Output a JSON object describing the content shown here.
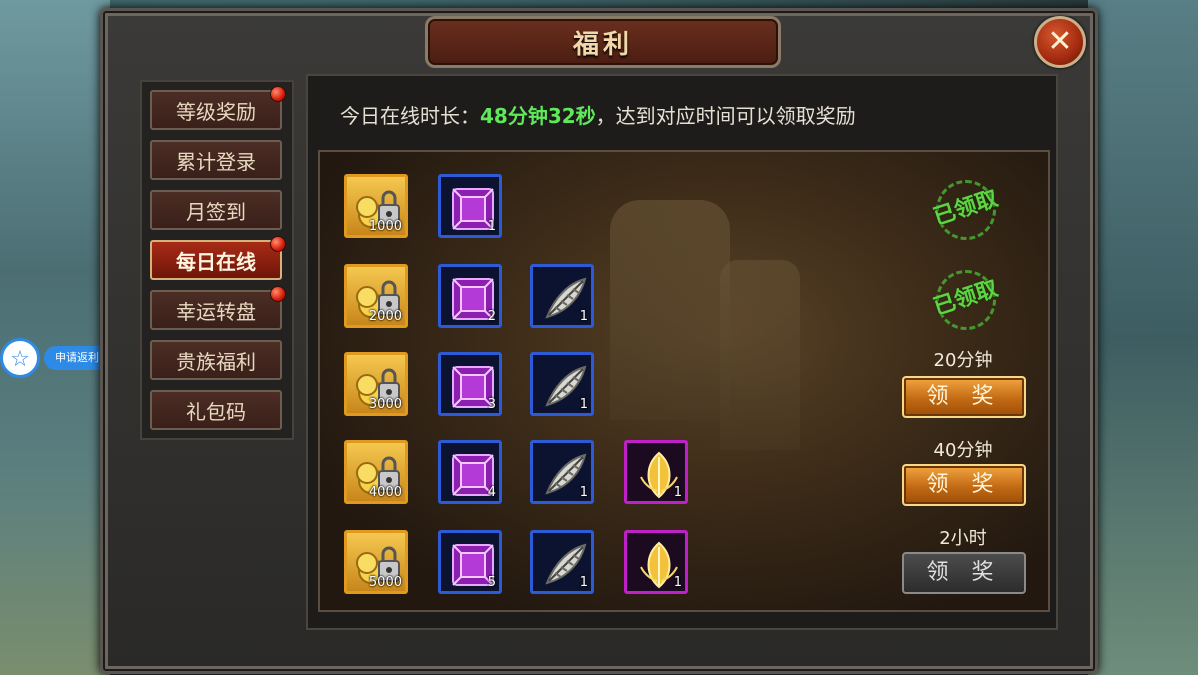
{
  "window": {
    "title": "福利",
    "close_label": "✕"
  },
  "tabs": [
    {
      "label": "等级奖励",
      "badge": true,
      "active": false
    },
    {
      "label": "累计登录",
      "badge": false,
      "active": false
    },
    {
      "label": "月签到",
      "badge": false,
      "active": false
    },
    {
      "label": "每日在线",
      "badge": true,
      "active": true
    },
    {
      "label": "幸运转盘",
      "badge": true,
      "active": false
    },
    {
      "label": "贵族福利",
      "badge": false,
      "active": false
    },
    {
      "label": "礼包码",
      "badge": false,
      "active": false
    }
  ],
  "online": {
    "prefix": "今日在线时长：",
    "value": "48分钟32秒",
    "suffix": "，达到对应时间可以领取奖励"
  },
  "rewards": [
    {
      "items": [
        {
          "type": "gold-lock",
          "count": "1000"
        },
        {
          "type": "purple-gem",
          "count": "1"
        }
      ],
      "status": "claimed",
      "stamp": "已领取"
    },
    {
      "items": [
        {
          "type": "gold-lock",
          "count": "2000"
        },
        {
          "type": "purple-gem",
          "count": "2"
        },
        {
          "type": "feather",
          "count": "1"
        }
      ],
      "status": "claimed",
      "stamp": "已领取"
    },
    {
      "items": [
        {
          "type": "gold-lock",
          "count": "3000"
        },
        {
          "type": "purple-gem",
          "count": "3"
        },
        {
          "type": "feather",
          "count": "1"
        }
      ],
      "status": "available",
      "time": "20分钟",
      "button": "领 奖"
    },
    {
      "items": [
        {
          "type": "gold-lock",
          "count": "4000"
        },
        {
          "type": "purple-gem",
          "count": "4"
        },
        {
          "type": "feather",
          "count": "1"
        },
        {
          "type": "golden-leaf",
          "count": "1"
        }
      ],
      "status": "available",
      "time": "40分钟",
      "button": "领 奖"
    },
    {
      "items": [
        {
          "type": "gold-lock",
          "count": "5000"
        },
        {
          "type": "purple-gem",
          "count": "5"
        },
        {
          "type": "feather",
          "count": "1"
        },
        {
          "type": "golden-leaf",
          "count": "1"
        }
      ],
      "status": "locked",
      "time": "2小时",
      "button": "领 奖"
    }
  ],
  "side_widget": {
    "label": "申请返利",
    "icon": "star-icon"
  },
  "colors": {
    "accent_green": "#5fe85a",
    "tab_active": "#a82b16",
    "button_orange": "#f2a640",
    "stamp_green": "#5fd443"
  }
}
